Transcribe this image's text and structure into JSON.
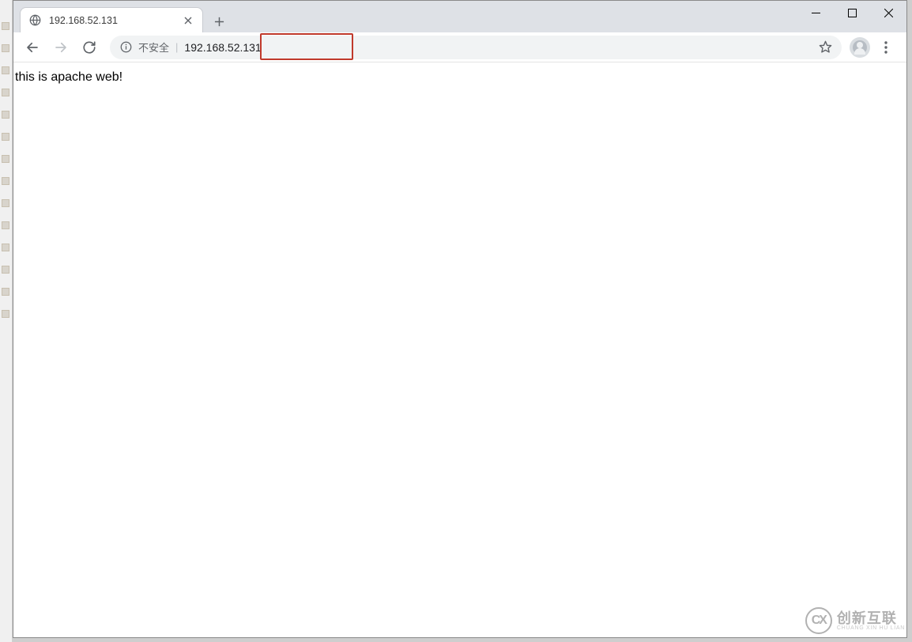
{
  "window_controls": {
    "minimize": "—",
    "maximize": "▭",
    "close": "✕"
  },
  "tab": {
    "title": "192.168.52.131"
  },
  "toolbar": {
    "security_label": "不安全",
    "url": "192.168.52.131"
  },
  "page": {
    "body_text": "this is apache web!"
  },
  "watermark": {
    "logo": "CX",
    "main": "创新互联",
    "sub": "CHUANG XIN HU LIAN"
  }
}
